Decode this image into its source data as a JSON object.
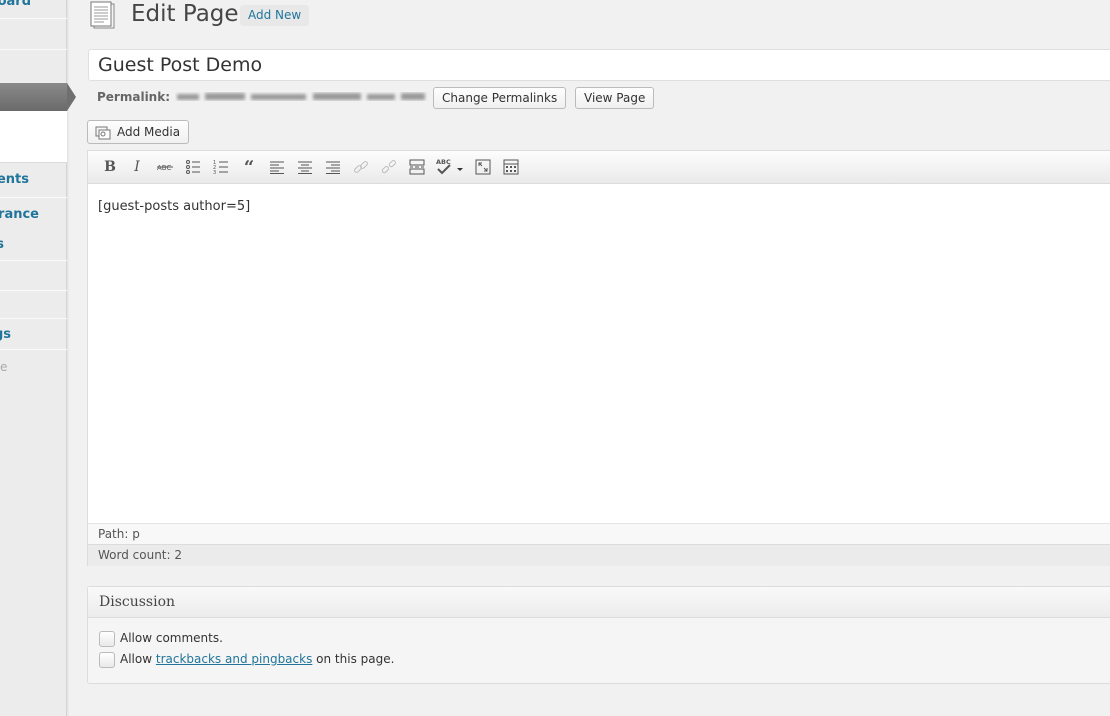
{
  "sidebar": {
    "items": [
      {
        "label": "Dashboard",
        "visible": "oard"
      },
      {
        "label": "Comments",
        "visible": "ents"
      },
      {
        "label": "Appearance",
        "visible": "rance"
      },
      {
        "label": "Plugins",
        "visible": "s"
      },
      {
        "label": "Settings",
        "visible": "gs"
      }
    ],
    "collapse_label": "Collapse menu",
    "collapse_visible": "e menu"
  },
  "header": {
    "title": "Edit Page",
    "add_new": "Add New"
  },
  "post_title": "Guest Post Demo",
  "permalink": {
    "label": "Permalink:",
    "change_button": "Change Permalinks",
    "view_button": "View Page"
  },
  "add_media": "Add Media",
  "editor": {
    "toolbar": [
      "bold",
      "italic",
      "strikethrough",
      "bullet-list",
      "numbered-list",
      "blockquote",
      "align-left",
      "align-center",
      "align-right",
      "insert-link",
      "remove-link",
      "insert-more",
      "spellcheck",
      "fullscreen",
      "toolbar-toggle"
    ],
    "content": "[guest-posts author=5]",
    "path": "Path: p",
    "word_count": "Word count: 2"
  },
  "discussion": {
    "title": "Discussion",
    "allow_comments": "Allow comments.",
    "allow_prefix": "Allow",
    "trackbacks_link": "trackbacks and pingbacks",
    "allow_suffix": "on this page."
  },
  "colors": {
    "link": "#21759b",
    "sidebar_bg": "#ececec",
    "page_bg": "#f1f1f1"
  }
}
